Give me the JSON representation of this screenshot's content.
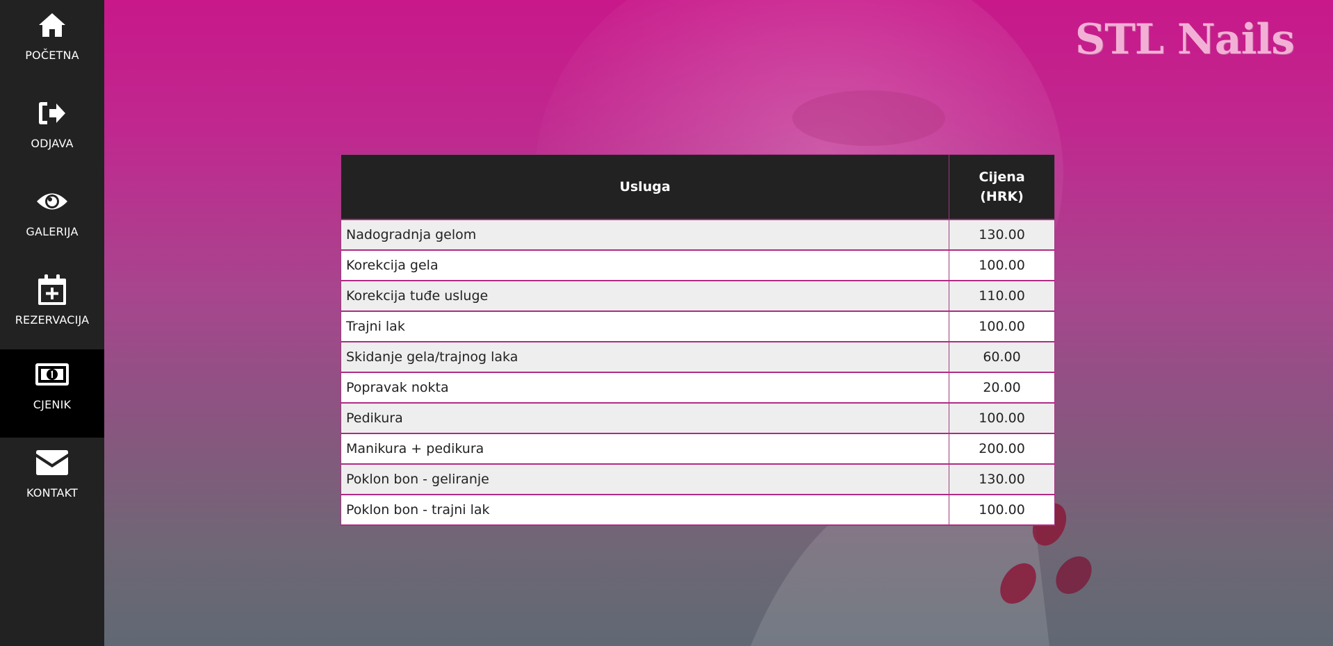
{
  "brand": {
    "logo_text": "STL Nails",
    "accent_color": "#c8188a"
  },
  "sidebar": {
    "items": [
      {
        "label": "POČETNA",
        "icon": "home-icon",
        "active": false
      },
      {
        "label": "ODJAVA",
        "icon": "logout-icon",
        "active": false
      },
      {
        "label": "GALERIJA",
        "icon": "eye-icon",
        "active": false
      },
      {
        "label": "REZERVACIJA",
        "icon": "calendar-plus-icon",
        "active": false
      },
      {
        "label": "CJENIK",
        "icon": "money-bill-icon",
        "active": true
      },
      {
        "label": "KONTAKT",
        "icon": "envelope-icon",
        "active": false
      }
    ]
  },
  "price_table": {
    "headers": {
      "service": "Usluga",
      "price_line1": "Cijena",
      "price_line2": "(HRK)"
    },
    "rows": [
      {
        "service": "Nadogradnja gelom",
        "price": "130.00"
      },
      {
        "service": "Korekcija gela",
        "price": "100.00"
      },
      {
        "service": "Korekcija tuđe usluge",
        "price": "110.00"
      },
      {
        "service": "Trajni lak",
        "price": "100.00"
      },
      {
        "service": "Skidanje gela/trajnog laka",
        "price": "60.00"
      },
      {
        "service": "Popravak nokta",
        "price": "20.00"
      },
      {
        "service": "Pedikura",
        "price": "100.00"
      },
      {
        "service": "Manikura + pedikura",
        "price": "200.00"
      },
      {
        "service": "Poklon bon - geliranje",
        "price": "130.00"
      },
      {
        "service": "Poklon bon - trajni lak",
        "price": "100.00"
      }
    ]
  }
}
